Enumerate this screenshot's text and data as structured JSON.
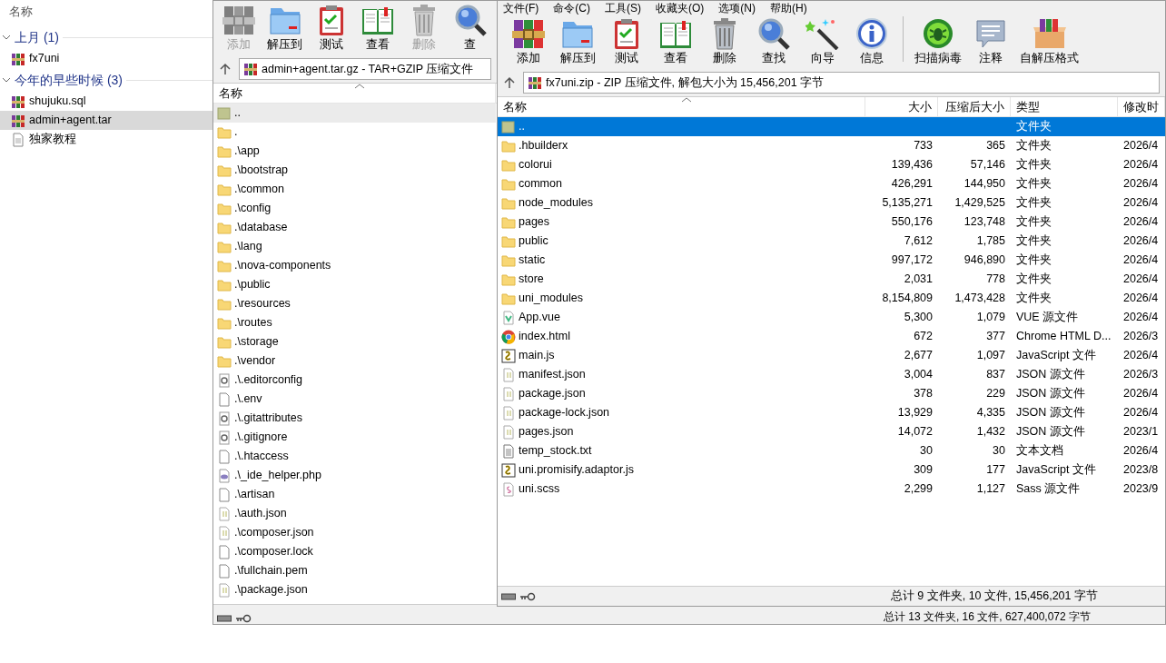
{
  "explorer": {
    "header": "名称",
    "groups": [
      {
        "label": "上月 (1)",
        "expanded": true,
        "items": [
          {
            "name": "fx7uni",
            "kind": "archive",
            "selected": false
          }
        ]
      },
      {
        "label": "今年的早些时候 (3)",
        "expanded": true,
        "items": [
          {
            "name": "shujuku.sql",
            "kind": "archive",
            "selected": false
          },
          {
            "name": "admin+agent.tar",
            "kind": "archive",
            "selected": true
          },
          {
            "name": "独家教程",
            "kind": "document",
            "selected": false
          }
        ]
      }
    ]
  },
  "back_window": {
    "toolbar": [
      {
        "label": "添加",
        "kind": "add",
        "disabled": true
      },
      {
        "label": "解压到",
        "kind": "extract",
        "disabled": false
      },
      {
        "label": "测试",
        "kind": "test",
        "disabled": false
      },
      {
        "label": "查看",
        "kind": "view",
        "disabled": false
      },
      {
        "label": "删除",
        "kind": "delete",
        "disabled": true
      },
      {
        "label": "查",
        "kind": "find",
        "disabled": false
      }
    ],
    "address": "admin+agent.tar.gz - TAR+GZIP 压缩文件",
    "columns": [
      "名称"
    ],
    "rows": [
      {
        "name": "..",
        "kind": "up"
      },
      {
        "name": ".",
        "kind": "folder"
      },
      {
        "name": ".\\app",
        "kind": "folder"
      },
      {
        "name": ".\\bootstrap",
        "kind": "folder"
      },
      {
        "name": ".\\common",
        "kind": "folder"
      },
      {
        "name": ".\\config",
        "kind": "folder"
      },
      {
        "name": ".\\database",
        "kind": "folder"
      },
      {
        "name": ".\\lang",
        "kind": "folder"
      },
      {
        "name": ".\\nova-components",
        "kind": "folder"
      },
      {
        "name": ".\\public",
        "kind": "folder"
      },
      {
        "name": ".\\resources",
        "kind": "folder"
      },
      {
        "name": ".\\routes",
        "kind": "folder"
      },
      {
        "name": ".\\storage",
        "kind": "folder"
      },
      {
        "name": ".\\vendor",
        "kind": "folder"
      },
      {
        "name": ".\\.editorconfig",
        "kind": "config"
      },
      {
        "name": ".\\.env",
        "kind": "file"
      },
      {
        "name": ".\\.gitattributes",
        "kind": "config"
      },
      {
        "name": ".\\.gitignore",
        "kind": "config"
      },
      {
        "name": ".\\.htaccess",
        "kind": "file"
      },
      {
        "name": ".\\_ide_helper.php",
        "kind": "php"
      },
      {
        "name": ".\\artisan",
        "kind": "file"
      },
      {
        "name": ".\\auth.json",
        "kind": "json"
      },
      {
        "name": ".\\composer.json",
        "kind": "json"
      },
      {
        "name": ".\\composer.lock",
        "kind": "file"
      },
      {
        "name": ".\\fullchain.pem",
        "kind": "file"
      },
      {
        "name": ".\\package.json",
        "kind": "json"
      }
    ],
    "status": "总计 13 文件夹, 16 文件, 627,400,072 字节"
  },
  "front_window": {
    "menu": [
      "文件(F)",
      "命令(C)",
      "工具(S)",
      "收藏夹(O)",
      "选项(N)",
      "帮助(H)"
    ],
    "toolbar": [
      {
        "label": "添加",
        "kind": "add",
        "disabled": false
      },
      {
        "label": "解压到",
        "kind": "extract",
        "disabled": false
      },
      {
        "label": "测试",
        "kind": "test",
        "disabled": false
      },
      {
        "label": "查看",
        "kind": "view",
        "disabled": false
      },
      {
        "label": "删除",
        "kind": "delete",
        "disabled": false
      },
      {
        "label": "查找",
        "kind": "find",
        "disabled": false
      },
      {
        "label": "向导",
        "kind": "wizard",
        "disabled": false
      },
      {
        "label": "信息",
        "kind": "info",
        "disabled": false
      },
      {
        "label": "扫描病毒",
        "kind": "scan",
        "disabled": false
      },
      {
        "label": "注释",
        "kind": "comment",
        "disabled": false
      },
      {
        "label": "自解压格式",
        "kind": "sfx",
        "disabled": false
      }
    ],
    "address": "fx7uni.zip - ZIP 压缩文件, 解包大小为 15,456,201 字节",
    "columns": [
      "名称",
      "大小",
      "压缩后大小",
      "类型",
      "修改时"
    ],
    "rows": [
      {
        "name": "..",
        "kind": "up",
        "size": "",
        "packed": "",
        "type": "文件夹",
        "modified": "",
        "selected": true
      },
      {
        "name": ".hbuilderx",
        "kind": "folder",
        "size": "733",
        "packed": "365",
        "type": "文件夹",
        "modified": "2026/4",
        "selected": false
      },
      {
        "name": "colorui",
        "kind": "folder",
        "size": "139,436",
        "packed": "57,146",
        "type": "文件夹",
        "modified": "2026/4",
        "selected": false
      },
      {
        "name": "common",
        "kind": "folder",
        "size": "426,291",
        "packed": "144,950",
        "type": "文件夹",
        "modified": "2026/4",
        "selected": false
      },
      {
        "name": "node_modules",
        "kind": "folder",
        "size": "5,135,271",
        "packed": "1,429,525",
        "type": "文件夹",
        "modified": "2026/4",
        "selected": false
      },
      {
        "name": "pages",
        "kind": "folder",
        "size": "550,176",
        "packed": "123,748",
        "type": "文件夹",
        "modified": "2026/4",
        "selected": false
      },
      {
        "name": "public",
        "kind": "folder",
        "size": "7,612",
        "packed": "1,785",
        "type": "文件夹",
        "modified": "2026/4",
        "selected": false
      },
      {
        "name": "static",
        "kind": "folder",
        "size": "997,172",
        "packed": "946,890",
        "type": "文件夹",
        "modified": "2026/4",
        "selected": false
      },
      {
        "name": "store",
        "kind": "folder",
        "size": "2,031",
        "packed": "778",
        "type": "文件夹",
        "modified": "2026/4",
        "selected": false
      },
      {
        "name": "uni_modules",
        "kind": "folder",
        "size": "8,154,809",
        "packed": "1,473,428",
        "type": "文件夹",
        "modified": "2026/4",
        "selected": false
      },
      {
        "name": "App.vue",
        "kind": "vue",
        "size": "5,300",
        "packed": "1,079",
        "type": "VUE 源文件",
        "modified": "2026/4",
        "selected": false
      },
      {
        "name": "index.html",
        "kind": "chrome",
        "size": "672",
        "packed": "377",
        "type": "Chrome HTML D...",
        "modified": "2026/3",
        "selected": false
      },
      {
        "name": "main.js",
        "kind": "js",
        "size": "2,677",
        "packed": "1,097",
        "type": "JavaScript 文件",
        "modified": "2026/4",
        "selected": false
      },
      {
        "name": "manifest.json",
        "kind": "json",
        "size": "3,004",
        "packed": "837",
        "type": "JSON 源文件",
        "modified": "2026/3",
        "selected": false
      },
      {
        "name": "package.json",
        "kind": "json",
        "size": "378",
        "packed": "229",
        "type": "JSON 源文件",
        "modified": "2026/4",
        "selected": false
      },
      {
        "name": "package-lock.json",
        "kind": "json",
        "size": "13,929",
        "packed": "4,335",
        "type": "JSON 源文件",
        "modified": "2026/4",
        "selected": false
      },
      {
        "name": "pages.json",
        "kind": "json",
        "size": "14,072",
        "packed": "1,432",
        "type": "JSON 源文件",
        "modified": "2023/1",
        "selected": false
      },
      {
        "name": "temp_stock.txt",
        "kind": "txt",
        "size": "30",
        "packed": "30",
        "type": "文本文档",
        "modified": "2026/4",
        "selected": false
      },
      {
        "name": "uni.promisify.adaptor.js",
        "kind": "js",
        "size": "309",
        "packed": "177",
        "type": "JavaScript 文件",
        "modified": "2023/8",
        "selected": false
      },
      {
        "name": "uni.scss",
        "kind": "sass",
        "size": "2,299",
        "packed": "1,127",
        "type": "Sass 源文件",
        "modified": "2023/9",
        "selected": false
      }
    ],
    "status": "总计 9 文件夹, 10 文件, 15,456,201 字节"
  }
}
